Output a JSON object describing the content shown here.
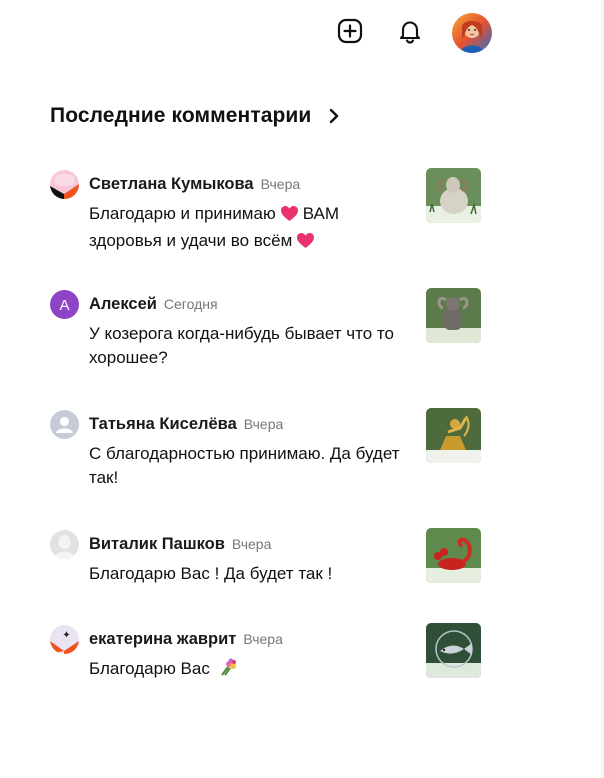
{
  "header": {
    "icons": [
      "plus-square-icon",
      "bell-icon"
    ],
    "avatar": "user-avatar"
  },
  "section": {
    "title": "Последние комментарии",
    "chevron": "chevron-right-icon"
  },
  "comments": [
    {
      "author": "Светлана Кумыкова",
      "time": "Вчера",
      "text_part1": "Благодарю и принимаю",
      "text_part2": "ВАМ здоровья и удачи во всём",
      "emoji": "heart-emoji",
      "thumbnail": "ram-thumbnail"
    },
    {
      "author": "Алексей",
      "time": "Сегодня",
      "avatar_letter": "А",
      "text": "У козерога когда-нибудь бывает что то хорошее?",
      "thumbnail": "goat-statue-thumbnail"
    },
    {
      "author": "Татьяна Киселёва",
      "time": "Вчера",
      "text": "С благодарностью принимаю. Да будет так!",
      "thumbnail": "golden-archer-thumbnail"
    },
    {
      "author": "Виталик Пашков",
      "time": "Вчера",
      "text": "Благодарю Вас ! Да будет так !",
      "thumbnail": "scorpion-thumbnail"
    },
    {
      "author": "екатерина жаврит",
      "time": "Вчера",
      "text": "Благодарю Вас",
      "emoji": "bouquet-emoji",
      "thumbnail": "fish-thumbnail"
    }
  ],
  "colors": {
    "heart": "#e8336d",
    "avatar_purple": "#8e44c7",
    "text_secondary": "#777777"
  }
}
